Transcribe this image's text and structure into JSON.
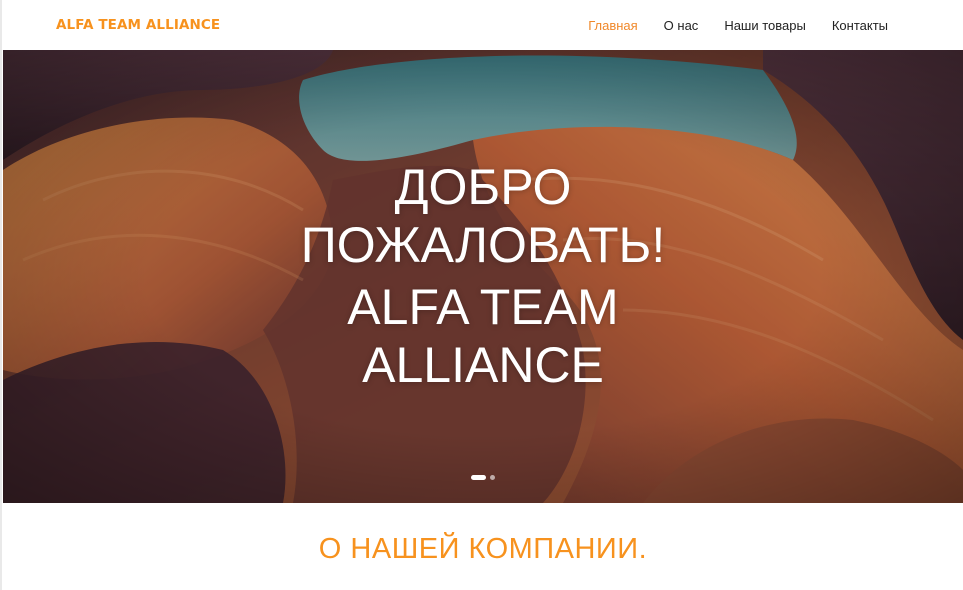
{
  "header": {
    "brand": "ALFA TEAM ALLIANCE",
    "nav": [
      {
        "label": "Главная",
        "active": true
      },
      {
        "label": "О нас",
        "active": false
      },
      {
        "label": "Наши товары",
        "active": false
      },
      {
        "label": "Контакты",
        "active": false
      }
    ]
  },
  "hero": {
    "line1": "ДОБРО",
    "line2": "ПОЖАЛОВАТЬ!",
    "line3": "ALFA TEAM",
    "line4": "ALLIANCE",
    "slides": {
      "count": 2,
      "active": 1
    },
    "image": "canyon-photo"
  },
  "about": {
    "title": "О НАШЕЙ КОМПАНИИ."
  },
  "colors": {
    "accent": "#f7921e",
    "nav_active": "#f0882a",
    "text": "#222222",
    "hero_text": "#ffffff"
  }
}
